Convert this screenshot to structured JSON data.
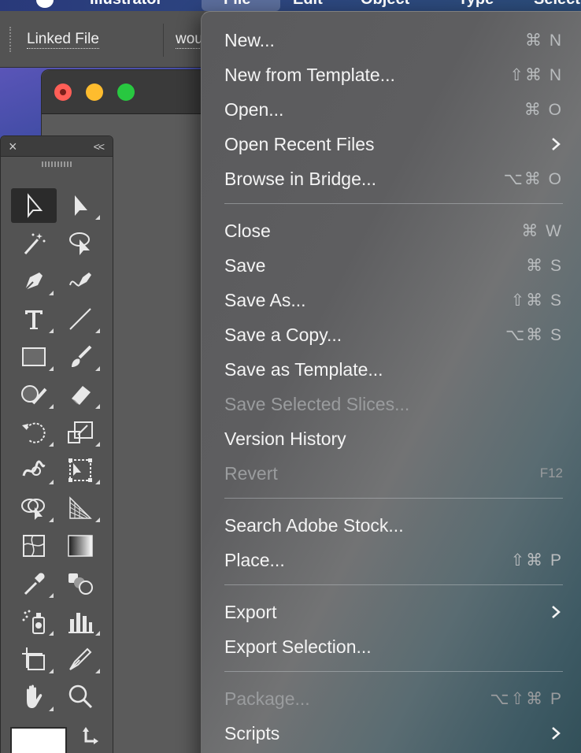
{
  "menubar": {
    "items": [
      "Illustrator",
      "File",
      "Edit",
      "Object",
      "Type",
      "Select"
    ]
  },
  "controlbar": {
    "linked_file": "Linked File",
    "filename_partial": "wou"
  },
  "toolpanel": {
    "close_glyph": "×",
    "collapse_glyph": "<<",
    "tools": [
      "selection-icon",
      "direct-selection-icon",
      "magic-wand-icon",
      "lasso-icon",
      "pen-icon",
      "curvature-icon",
      "type-icon",
      "line-segment-icon",
      "rectangle-icon",
      "paintbrush-icon",
      "shaper-icon",
      "eraser-icon",
      "rotate-icon",
      "scale-icon",
      "warp-icon",
      "free-transform-icon",
      "shape-builder-icon",
      "perspective-grid-icon",
      "mesh-icon",
      "gradient-icon",
      "eyedropper-icon",
      "blend-icon",
      "symbol-sprayer-icon",
      "column-graph-icon",
      "artboard-icon",
      "slice-icon",
      "hand-icon",
      "zoom-icon"
    ]
  },
  "file_menu": {
    "items": [
      {
        "label": "New...",
        "shortcut": "⌘ N"
      },
      {
        "label": "New from Template...",
        "shortcut": "⇧⌘ N"
      },
      {
        "label": "Open...",
        "shortcut": "⌘ O"
      },
      {
        "label": "Open Recent Files",
        "shortcut": "",
        "submenu": true
      },
      {
        "label": "Browse in Bridge...",
        "shortcut": "⌥⌘ O"
      },
      {
        "label": "Close",
        "shortcut": "⌘ W"
      },
      {
        "label": "Save",
        "shortcut": "⌘ S"
      },
      {
        "label": "Save As...",
        "shortcut": "⇧⌘ S"
      },
      {
        "label": "Save a Copy...",
        "shortcut": "⌥⌘ S"
      },
      {
        "label": "Save as Template...",
        "shortcut": ""
      },
      {
        "label": "Save Selected Slices...",
        "shortcut": "",
        "disabled": true
      },
      {
        "label": "Version History",
        "shortcut": ""
      },
      {
        "label": "Revert",
        "shortcut": "F12",
        "disabled": true
      },
      {
        "label": "Search Adobe Stock...",
        "shortcut": ""
      },
      {
        "label": "Place...",
        "shortcut": "⇧⌘ P"
      },
      {
        "label": "Export",
        "shortcut": "",
        "submenu": true
      },
      {
        "label": "Export Selection...",
        "shortcut": ""
      },
      {
        "label": "Package...",
        "shortcut": "⌥⇧⌘ P",
        "disabled": true
      },
      {
        "label": "Scripts",
        "shortcut": "",
        "submenu": true
      }
    ]
  }
}
